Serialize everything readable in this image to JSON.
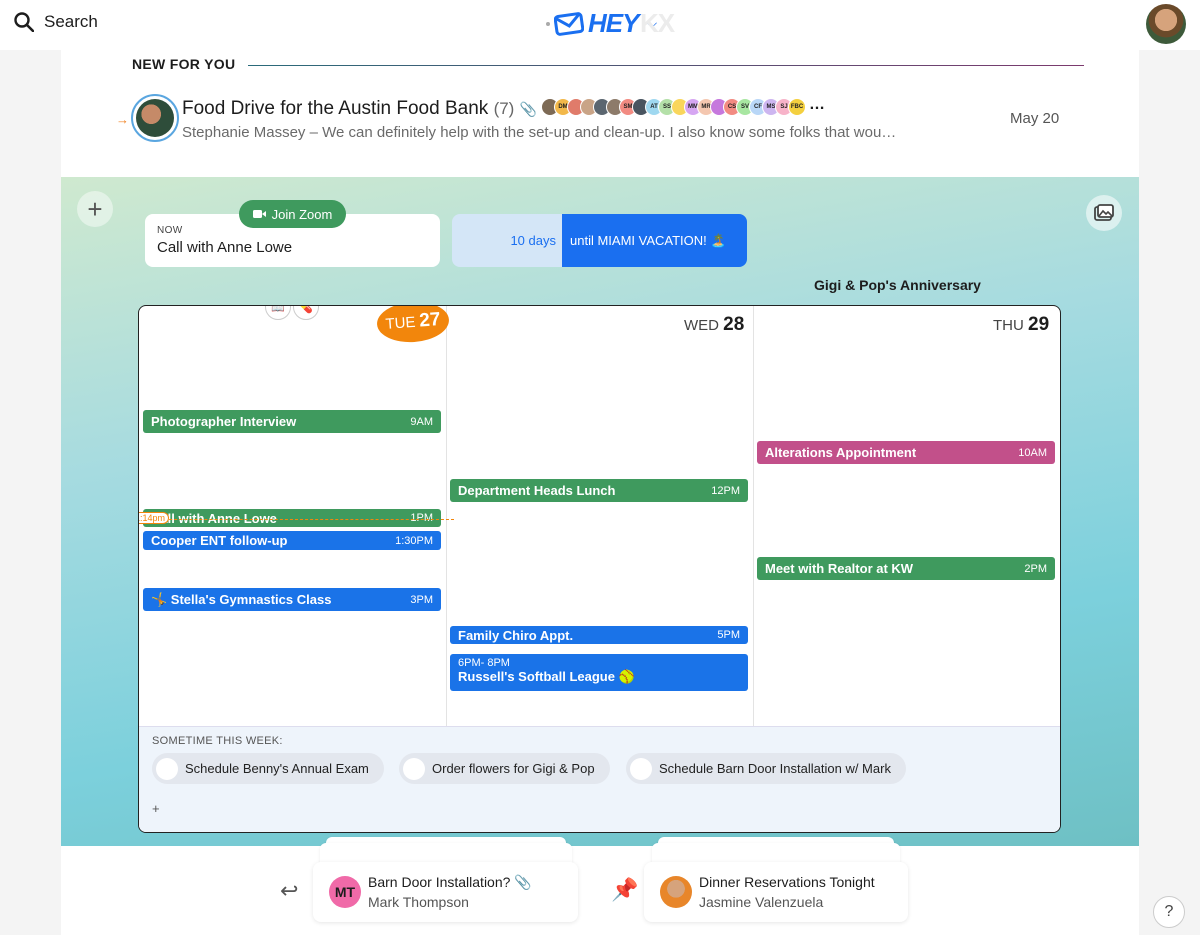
{
  "header": {
    "search_label": "Search",
    "logo_text": "HEY",
    "logo_ghost": "KX"
  },
  "new_for_you": {
    "title": "NEW FOR YOU",
    "email": {
      "subject": "Food Drive for the Austin Food Bank",
      "count": "(7)",
      "participants": [
        "",
        "DM",
        "",
        "",
        "",
        "",
        "SM",
        "",
        "AT",
        "SS",
        "",
        "MM",
        "MR",
        "",
        "CS",
        "SV",
        "CF",
        "MS",
        "SJ",
        "FBC"
      ],
      "more": "…",
      "preview": "Stephanie Massey – We can definitely help with the set-up and clean-up. I also know some folks that wou…",
      "date": "May 20"
    }
  },
  "now_card": {
    "label": "NOW",
    "title": "Call with Anne Lowe",
    "zoom_label": "Join Zoom"
  },
  "countdown": {
    "days": "10 days",
    "text": "until MIAMI VACATION! 🏝️"
  },
  "anniversary": "Gigi & Pop's Anniversary",
  "calendar": {
    "days": [
      {
        "dow": "TUE",
        "num": "27"
      },
      {
        "dow": "WED",
        "num": "28"
      },
      {
        "dow": "THU",
        "num": "29"
      }
    ],
    "now_badge": "1:14pm",
    "events": {
      "tue": [
        {
          "name": "Photographer Interview",
          "time": "9AM"
        },
        {
          "name": "Call with Anne Lowe",
          "time": "1PM"
        },
        {
          "name": "Cooper ENT follow-up",
          "time": "1:30PM"
        },
        {
          "name": "🤸 Stella's Gymnastics Class",
          "time": "3PM"
        }
      ],
      "wed": [
        {
          "name": "Department Heads Lunch",
          "time": "12PM"
        },
        {
          "name": "Family Chiro Appt.",
          "time": "5PM"
        },
        {
          "name": "Russell's Softball League 🥎",
          "time": "6PM- 8PM"
        }
      ],
      "thu": [
        {
          "name": "Alterations Appointment",
          "time": "10AM"
        },
        {
          "name": "Meet with Realtor at KW",
          "time": "2PM"
        }
      ]
    },
    "sometime": {
      "label": "SOMETIME THIS WEEK:",
      "items": [
        "Schedule Benny's Annual Exam",
        "Order flowers for Gigi & Pop",
        "Schedule Barn Door Installation w/ Mark"
      ],
      "add": "+"
    }
  },
  "reply_later": {
    "subject": "Barn Door Installation?",
    "from": "Mark Thompson",
    "initials": "MT"
  },
  "set_aside": {
    "subject": "Dinner Reservations Tonight",
    "from": "Jasmine Valenzuela"
  },
  "help": "?",
  "colors": {
    "accent_blue": "#1a73e8",
    "green": "#3f9a5e",
    "pink": "#c2508a",
    "orange": "#f2860c"
  }
}
